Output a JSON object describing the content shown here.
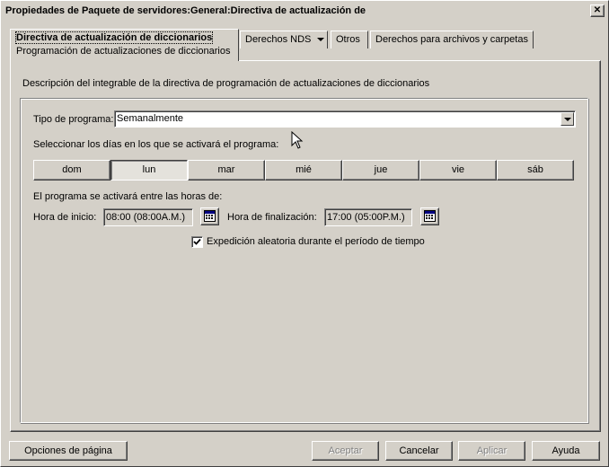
{
  "window": {
    "title": "Propiedades de Paquete de servidores:General:Directiva de actualización de",
    "close_glyph": "✕"
  },
  "tabs": {
    "active_label": "Directiva de actualización de diccionarios",
    "active_sublabel": "Programación de actualizaciones de diccionarios",
    "nds_label": "Derechos NDS",
    "others_label": "Otros",
    "file_rights_label": "Derechos para archivos y carpetas"
  },
  "panel": {
    "description": "Descripción del integrable de la directiva de programación de actualizaciones de diccionarios",
    "schedule_type_label": "Tipo de programa:",
    "schedule_type_value": "Semanalmente",
    "days_prompt": "Seleccionar los días en los que se activará el programa:",
    "days": [
      {
        "label": "dom",
        "selected": false
      },
      {
        "label": "lun",
        "selected": true
      },
      {
        "label": "mar",
        "selected": false
      },
      {
        "label": "mié",
        "selected": false
      },
      {
        "label": "jue",
        "selected": false
      },
      {
        "label": "vie",
        "selected": false
      },
      {
        "label": "sáb",
        "selected": false
      }
    ],
    "hours_prompt": "El programa se activará entre las horas de:",
    "start_label": "Hora de inicio:",
    "start_value": "08:00 (08:00A.M.)",
    "end_label": "Hora de finalización:",
    "end_value": "17:00 (05:00P.M.)",
    "random_dispatch_label": "Expedición aleatoria durante el período de tiempo",
    "random_dispatch_checked": true
  },
  "footer": {
    "page_options": "Opciones de página",
    "accept": "Aceptar",
    "cancel": "Cancelar",
    "apply": "Aplicar",
    "help": "Ayuda"
  }
}
